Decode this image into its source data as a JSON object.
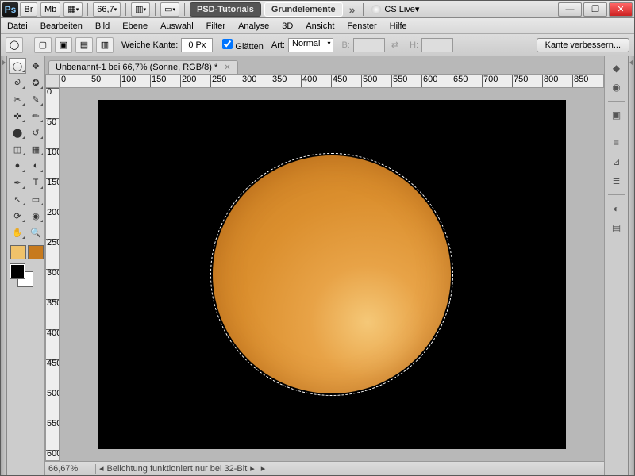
{
  "titlebar": {
    "logo": "Ps",
    "br": "Br",
    "mb": "Mb",
    "zoom": "66,7",
    "tabs": [
      "PSD-Tutorials",
      "Grundelemente"
    ],
    "cslive": "CS Live"
  },
  "menu": [
    "Datei",
    "Bearbeiten",
    "Bild",
    "Ebene",
    "Auswahl",
    "Filter",
    "Analyse",
    "3D",
    "Ansicht",
    "Fenster",
    "Hilfe"
  ],
  "options": {
    "feather_label": "Weiche Kante:",
    "feather_value": "0 Px",
    "antialias_label": "Glätten",
    "antialias_checked": true,
    "style_label": "Art:",
    "style_value": "Normal",
    "w_label": "B:",
    "h_label": "H:",
    "refine_btn": "Kante verbessern..."
  },
  "doc": {
    "tab": "Unbenannt-1 bei 66,7% (Sonne, RGB/8) *"
  },
  "ruler_h": [
    "0",
    "50",
    "100",
    "150",
    "200",
    "250",
    "300",
    "350",
    "400",
    "450",
    "500",
    "550",
    "600",
    "650",
    "700",
    "750",
    "800",
    "850"
  ],
  "ruler_v": [
    "0",
    "50",
    "100",
    "150",
    "200",
    "250",
    "300",
    "350",
    "400",
    "450",
    "500",
    "550",
    "600"
  ],
  "swatches": [
    "#f0c26a",
    "#c77a1e"
  ],
  "status": {
    "zoom": "66,67%",
    "info": "Belichtung funktioniert nur bei 32-Bit"
  }
}
